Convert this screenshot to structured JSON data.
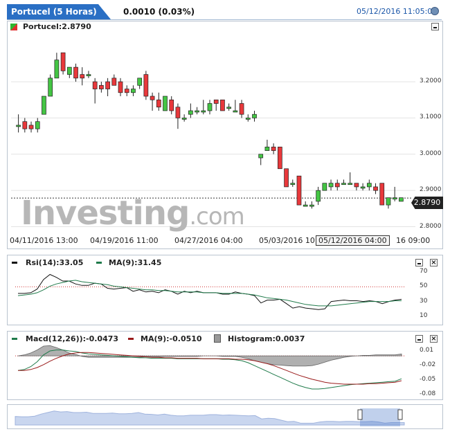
{
  "header": {
    "title": "Portucel (5 Horas)",
    "change": "0.0010 (0.03%)",
    "datetime": "05/12/2016 11:05:01",
    "clock_icon": "clock-icon"
  },
  "price_panel": {
    "legend": "Portucel:2.8790",
    "watermark": "Investing.com",
    "y_ticks": [
      "3.2000",
      "3.1000",
      "3.0000",
      "2.9000",
      "2.8000"
    ],
    "x_labels": [
      "04/11/2016 13:00",
      "04/19/2016 11:00",
      "04/27/2016 04:00",
      "05/03/2016 10",
      "05/12/2016 04:00",
      "16 09:00"
    ],
    "last_price": "2.8790",
    "colors": {
      "up": "#44c544",
      "down": "#e8383b"
    }
  },
  "rsi_panel": {
    "legend_rsi": "Rsi(14):33.05",
    "legend_ma": "MA(9):31.45",
    "y_ticks": [
      "70",
      "50",
      "30",
      "10"
    ]
  },
  "macd_panel": {
    "legend_macd": "Macd(12,26)):-0.0473",
    "legend_ma": "MA(9):-0.0510",
    "legend_hist": "Histogram:0.0037",
    "y_ticks": [
      "0.01",
      "-0.02",
      "-0.05",
      "-0.08"
    ]
  },
  "chart_data": [
    {
      "type": "candlestick",
      "title": "Portucel (5 Horas)",
      "ylim": [
        2.78,
        3.33
      ],
      "candles": [
        {
          "o": 3.08,
          "h": 3.11,
          "l": 3.06,
          "c": 3.08
        },
        {
          "o": 3.09,
          "h": 3.1,
          "l": 3.06,
          "c": 3.07
        },
        {
          "o": 3.08,
          "h": 3.09,
          "l": 3.06,
          "c": 3.07
        },
        {
          "o": 3.07,
          "h": 3.1,
          "l": 3.06,
          "c": 3.09
        },
        {
          "o": 3.11,
          "h": 3.16,
          "l": 3.11,
          "c": 3.16
        },
        {
          "o": 3.16,
          "h": 3.22,
          "l": 3.16,
          "c": 3.21
        },
        {
          "o": 3.21,
          "h": 3.28,
          "l": 3.21,
          "c": 3.26
        },
        {
          "o": 3.28,
          "h": 3.28,
          "l": 3.22,
          "c": 3.23
        },
        {
          "o": 3.22,
          "h": 3.24,
          "l": 3.21,
          "c": 3.24
        },
        {
          "o": 3.24,
          "h": 3.25,
          "l": 3.2,
          "c": 3.21
        },
        {
          "o": 3.22,
          "h": 3.24,
          "l": 3.19,
          "c": 3.21
        },
        {
          "o": 3.22,
          "h": 3.23,
          "l": 3.21,
          "c": 3.22
        },
        {
          "o": 3.2,
          "h": 3.21,
          "l": 3.14,
          "c": 3.18
        },
        {
          "o": 3.19,
          "h": 3.2,
          "l": 3.17,
          "c": 3.18
        },
        {
          "o": 3.2,
          "h": 3.21,
          "l": 3.16,
          "c": 3.18
        },
        {
          "o": 3.21,
          "h": 3.22,
          "l": 3.19,
          "c": 3.19
        },
        {
          "o": 3.2,
          "h": 3.21,
          "l": 3.16,
          "c": 3.17
        },
        {
          "o": 3.18,
          "h": 3.19,
          "l": 3.16,
          "c": 3.17
        },
        {
          "o": 3.17,
          "h": 3.19,
          "l": 3.16,
          "c": 3.18
        },
        {
          "o": 3.19,
          "h": 3.21,
          "l": 3.18,
          "c": 3.21
        },
        {
          "o": 3.22,
          "h": 3.23,
          "l": 3.15,
          "c": 3.16
        },
        {
          "o": 3.16,
          "h": 3.17,
          "l": 3.12,
          "c": 3.15
        },
        {
          "o": 3.15,
          "h": 3.17,
          "l": 3.12,
          "c": 3.13
        },
        {
          "o": 3.12,
          "h": 3.16,
          "l": 3.12,
          "c": 3.16
        },
        {
          "o": 3.15,
          "h": 3.16,
          "l": 3.11,
          "c": 3.12
        },
        {
          "o": 3.13,
          "h": 3.14,
          "l": 3.07,
          "c": 3.1
        },
        {
          "o": 3.1,
          "h": 3.11,
          "l": 3.09,
          "c": 3.1
        },
        {
          "o": 3.11,
          "h": 3.14,
          "l": 3.1,
          "c": 3.12
        },
        {
          "o": 3.12,
          "h": 3.13,
          "l": 3.11,
          "c": 3.12
        },
        {
          "o": 3.12,
          "h": 3.15,
          "l": 3.11,
          "c": 3.12
        },
        {
          "o": 3.12,
          "h": 3.15,
          "l": 3.11,
          "c": 3.14
        },
        {
          "o": 3.15,
          "h": 3.15,
          "l": 3.12,
          "c": 3.14
        },
        {
          "o": 3.15,
          "h": 3.15,
          "l": 3.12,
          "c": 3.12
        },
        {
          "o": 3.13,
          "h": 3.14,
          "l": 3.12,
          "c": 3.13
        },
        {
          "o": 3.12,
          "h": 3.15,
          "l": 3.12,
          "c": 3.12
        },
        {
          "o": 3.14,
          "h": 3.15,
          "l": 3.1,
          "c": 3.11
        },
        {
          "o": 3.1,
          "h": 3.11,
          "l": 3.09,
          "c": 3.1
        },
        {
          "o": 3.1,
          "h": 3.12,
          "l": 3.09,
          "c": 3.11
        },
        {
          "o": 2.99,
          "h": 3.0,
          "l": 2.97,
          "c": 3.0
        },
        {
          "o": 3.01,
          "h": 3.04,
          "l": 3.01,
          "c": 3.02
        },
        {
          "o": 3.02,
          "h": 3.03,
          "l": 3.0,
          "c": 3.01
        },
        {
          "o": 3.02,
          "h": 3.02,
          "l": 2.96,
          "c": 2.96
        },
        {
          "o": 2.96,
          "h": 2.96,
          "l": 2.91,
          "c": 2.91
        },
        {
          "o": 2.92,
          "h": 2.93,
          "l": 2.91,
          "c": 2.92
        },
        {
          "o": 2.94,
          "h": 2.94,
          "l": 2.86,
          "c": 2.86
        },
        {
          "o": 2.86,
          "h": 2.87,
          "l": 2.86,
          "c": 2.86
        },
        {
          "o": 2.86,
          "h": 2.87,
          "l": 2.85,
          "c": 2.86
        },
        {
          "o": 2.87,
          "h": 2.91,
          "l": 2.86,
          "c": 2.9
        },
        {
          "o": 2.9,
          "h": 2.92,
          "l": 2.9,
          "c": 2.92
        },
        {
          "o": 2.91,
          "h": 2.93,
          "l": 2.9,
          "c": 2.92
        },
        {
          "o": 2.92,
          "h": 2.93,
          "l": 2.9,
          "c": 2.91
        },
        {
          "o": 2.92,
          "h": 2.93,
          "l": 2.92,
          "c": 2.92
        },
        {
          "o": 2.92,
          "h": 2.95,
          "l": 2.92,
          "c": 2.92
        },
        {
          "o": 2.92,
          "h": 2.92,
          "l": 2.9,
          "c": 2.91
        },
        {
          "o": 2.91,
          "h": 2.92,
          "l": 2.9,
          "c": 2.91
        },
        {
          "o": 2.91,
          "h": 2.93,
          "l": 2.9,
          "c": 2.92
        },
        {
          "o": 2.91,
          "h": 2.92,
          "l": 2.89,
          "c": 2.9
        },
        {
          "o": 2.92,
          "h": 2.92,
          "l": 2.86,
          "c": 2.86
        },
        {
          "o": 2.86,
          "h": 2.88,
          "l": 2.85,
          "c": 2.88
        },
        {
          "o": 2.88,
          "h": 2.91,
          "l": 2.87,
          "c": 2.88
        },
        {
          "o": 2.87,
          "h": 2.88,
          "l": 2.87,
          "c": 2.88
        }
      ],
      "last_price": 2.879
    },
    {
      "type": "line",
      "title": "Rsi(14)",
      "ylim": [
        5,
        75
      ],
      "reference_line": 50,
      "series": [
        {
          "name": "Rsi(14)",
          "values": [
            41,
            41,
            42,
            47,
            60,
            67,
            63,
            58,
            58,
            54,
            52,
            52,
            55,
            54,
            48,
            47,
            48,
            49,
            44,
            46,
            43,
            44,
            42,
            46,
            44,
            40,
            44,
            42,
            44,
            42,
            42,
            42,
            40,
            40,
            43,
            41,
            40,
            38,
            28,
            32,
            32,
            33,
            27,
            21,
            23,
            21,
            20,
            19,
            20,
            30,
            31,
            32,
            31,
            31,
            30,
            31,
            30,
            27,
            30,
            32,
            33
          ]
        },
        {
          "name": "MA(9)",
          "values": [
            38,
            39,
            40,
            42,
            46,
            51,
            54,
            56,
            58,
            59,
            57,
            56,
            55,
            54,
            53,
            51,
            50,
            49,
            48,
            47,
            46,
            46,
            45,
            45,
            44,
            43,
            43,
            43,
            43,
            42,
            42,
            42,
            41,
            41,
            41,
            41,
            40,
            39,
            37,
            35,
            34,
            33,
            32,
            30,
            28,
            26,
            25,
            24,
            24,
            24,
            25,
            26,
            27,
            28,
            29,
            30,
            30,
            30,
            30,
            31,
            31
          ]
        }
      ]
    },
    {
      "type": "line",
      "title": "Macd(12,26))",
      "ylim": [
        -0.085,
        0.02
      ],
      "reference_line": 0,
      "series": [
        {
          "name": "Macd(12,26))",
          "values": [
            -0.03,
            -0.028,
            -0.022,
            -0.012,
            0.002,
            0.01,
            0.012,
            0.012,
            0.01,
            0.009,
            0.006,
            0.004,
            0.003,
            0.002,
            0.001,
            0.0,
            -0.001,
            -0.002,
            -0.003,
            -0.004,
            -0.004,
            -0.005,
            -0.005,
            -0.005,
            -0.005,
            -0.006,
            -0.006,
            -0.006,
            -0.006,
            -0.006,
            -0.006,
            -0.006,
            -0.007,
            -0.007,
            -0.008,
            -0.01,
            -0.014,
            -0.02,
            -0.026,
            -0.032,
            -0.038,
            -0.044,
            -0.05,
            -0.056,
            -0.061,
            -0.065,
            -0.068,
            -0.068,
            -0.067,
            -0.065,
            -0.063,
            -0.061,
            -0.059,
            -0.058,
            -0.057,
            -0.056,
            -0.055,
            -0.054,
            -0.053,
            -0.052,
            -0.047
          ]
        },
        {
          "name": "MA(9)",
          "values": [
            -0.03,
            -0.03,
            -0.028,
            -0.024,
            -0.018,
            -0.011,
            -0.005,
            0.0,
            0.004,
            0.006,
            0.007,
            0.007,
            0.006,
            0.005,
            0.004,
            0.003,
            0.002,
            0.001,
            0.0,
            -0.001,
            -0.002,
            -0.003,
            -0.003,
            -0.004,
            -0.004,
            -0.005,
            -0.005,
            -0.005,
            -0.005,
            -0.006,
            -0.006,
            -0.006,
            -0.006,
            -0.006,
            -0.007,
            -0.007,
            -0.008,
            -0.01,
            -0.013,
            -0.016,
            -0.02,
            -0.025,
            -0.03,
            -0.035,
            -0.04,
            -0.044,
            -0.048,
            -0.051,
            -0.054,
            -0.056,
            -0.057,
            -0.058,
            -0.058,
            -0.058,
            -0.058,
            -0.057,
            -0.057,
            -0.056,
            -0.055,
            -0.054,
            -0.051
          ]
        }
      ]
    }
  ]
}
